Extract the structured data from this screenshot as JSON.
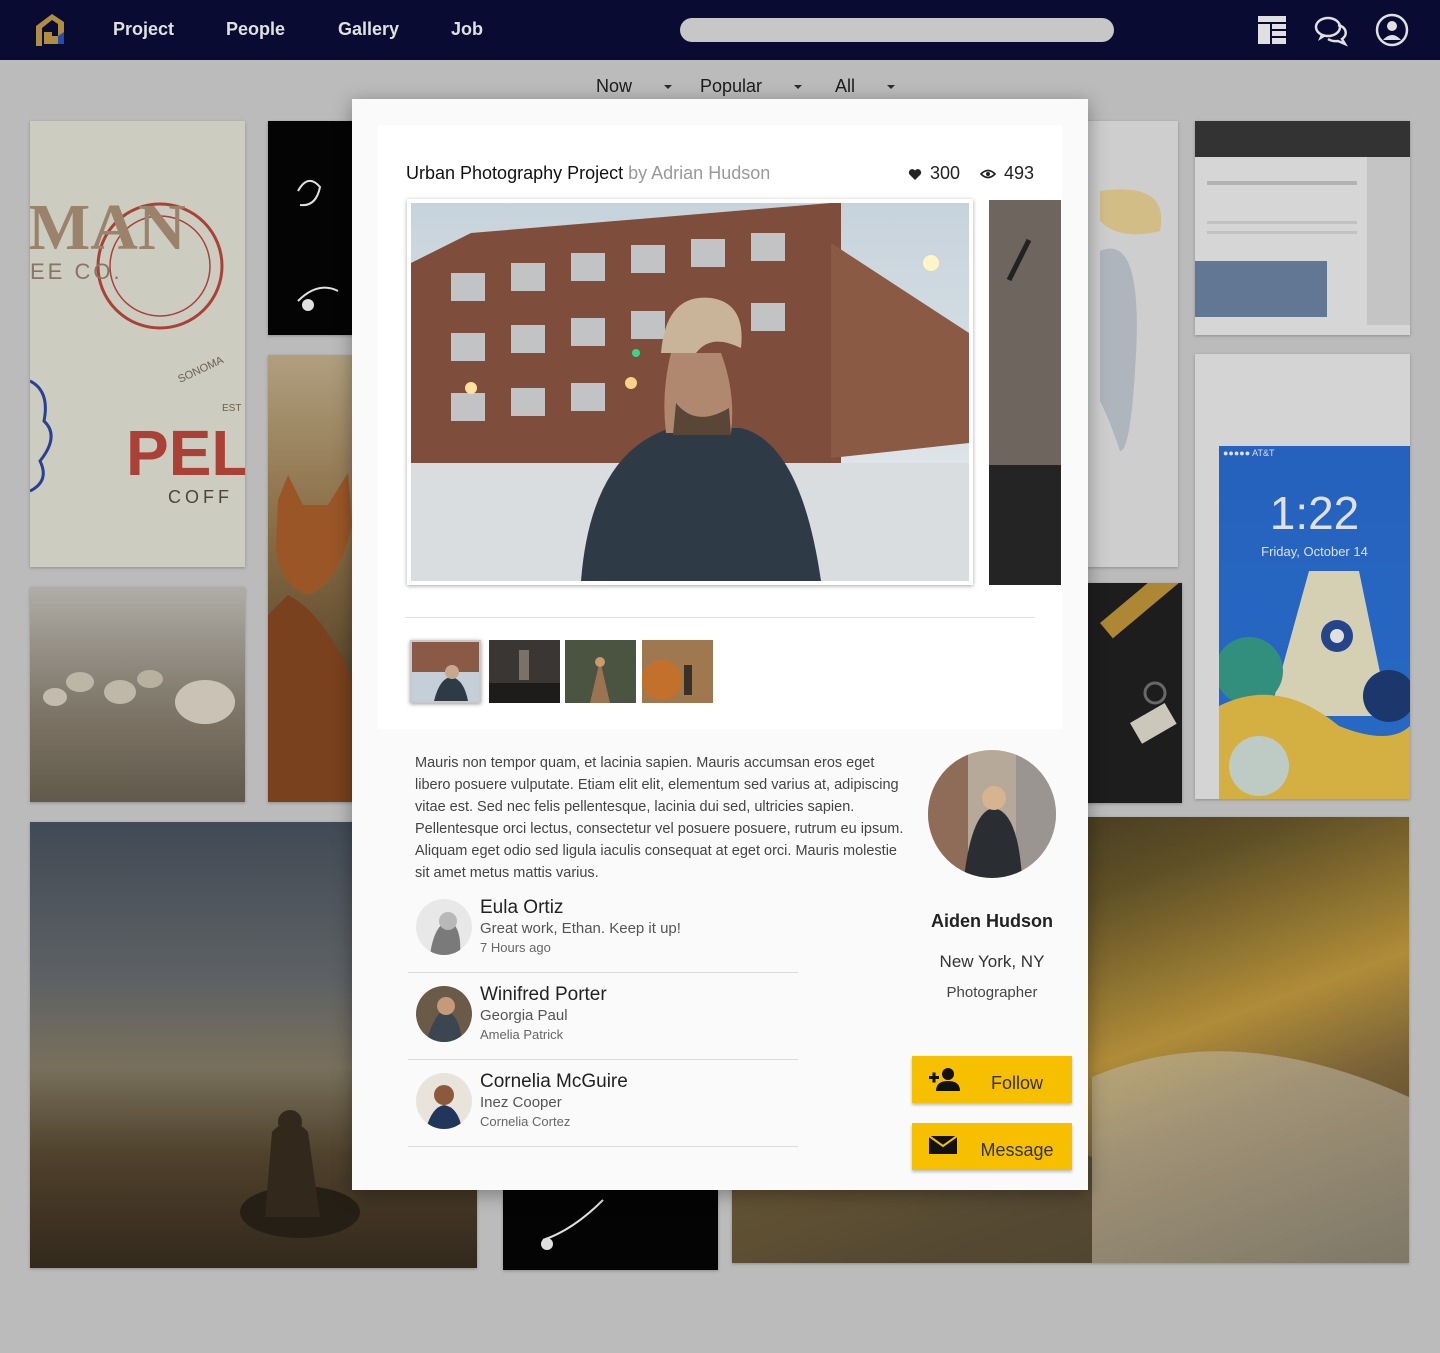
{
  "nav": {
    "links": [
      "Project",
      "People",
      "Gallery",
      "Job"
    ],
    "search_placeholder": "",
    "colors": {
      "bar": "#0b0d3a",
      "logo_gold": "#c9a14a",
      "logo_blue": "#2e56c4"
    },
    "icons": [
      "layout-grid-icon",
      "chat-bubbles-icon",
      "user-account-icon"
    ]
  },
  "filters": [
    {
      "label": "Now"
    },
    {
      "label": "Popular"
    },
    {
      "label": "All"
    }
  ],
  "gallery": {
    "tile_mman": "MAN",
    "tile_coffee_co": "EE CO.",
    "tile_sonoma": "SONOMA",
    "tile_est": "EST",
    "tile_pel": "PEL",
    "tile_coffee": "COFF",
    "phone_carrier": "●●●●● AT&T",
    "phone_time": "1:22",
    "phone_date": "Friday, October 14"
  },
  "project": {
    "title": "Urban Photography Project",
    "by": "by Adrian Hudson",
    "likes": "300",
    "views": "493",
    "description": "Mauris non tempor quam, et lacinia sapien. Mauris accumsan eros eget libero posuere vulputate. Etiam elit elit, elementum sed varius at, adipiscing vitae est. Sed nec felis pellentesque, lacinia dui sed, ultricies sapien. Pellentesque orci lectus, consectetur vel posuere posuere, rutrum eu ipsum. Aliquam eget odio sed ligula iaculis consequat at eget orci. Mauris molestie sit amet metus mattis varius."
  },
  "comments": [
    {
      "name": "Eula Ortiz",
      "text": "Great work, Ethan. Keep it up!",
      "sub": "7 Hours ago"
    },
    {
      "name": "Winifred Porter",
      "text": "Georgia Paul",
      "sub": "Amelia Patrick"
    },
    {
      "name": "Cornelia McGuire",
      "text": "Inez Cooper",
      "sub": "Cornelia Cortez"
    }
  ],
  "profile": {
    "name": "Aiden Hudson",
    "location": "New York, NY",
    "role": "Photographer",
    "follow_label": "Follow",
    "message_label": "Message",
    "button_color": "#f6bf00"
  }
}
